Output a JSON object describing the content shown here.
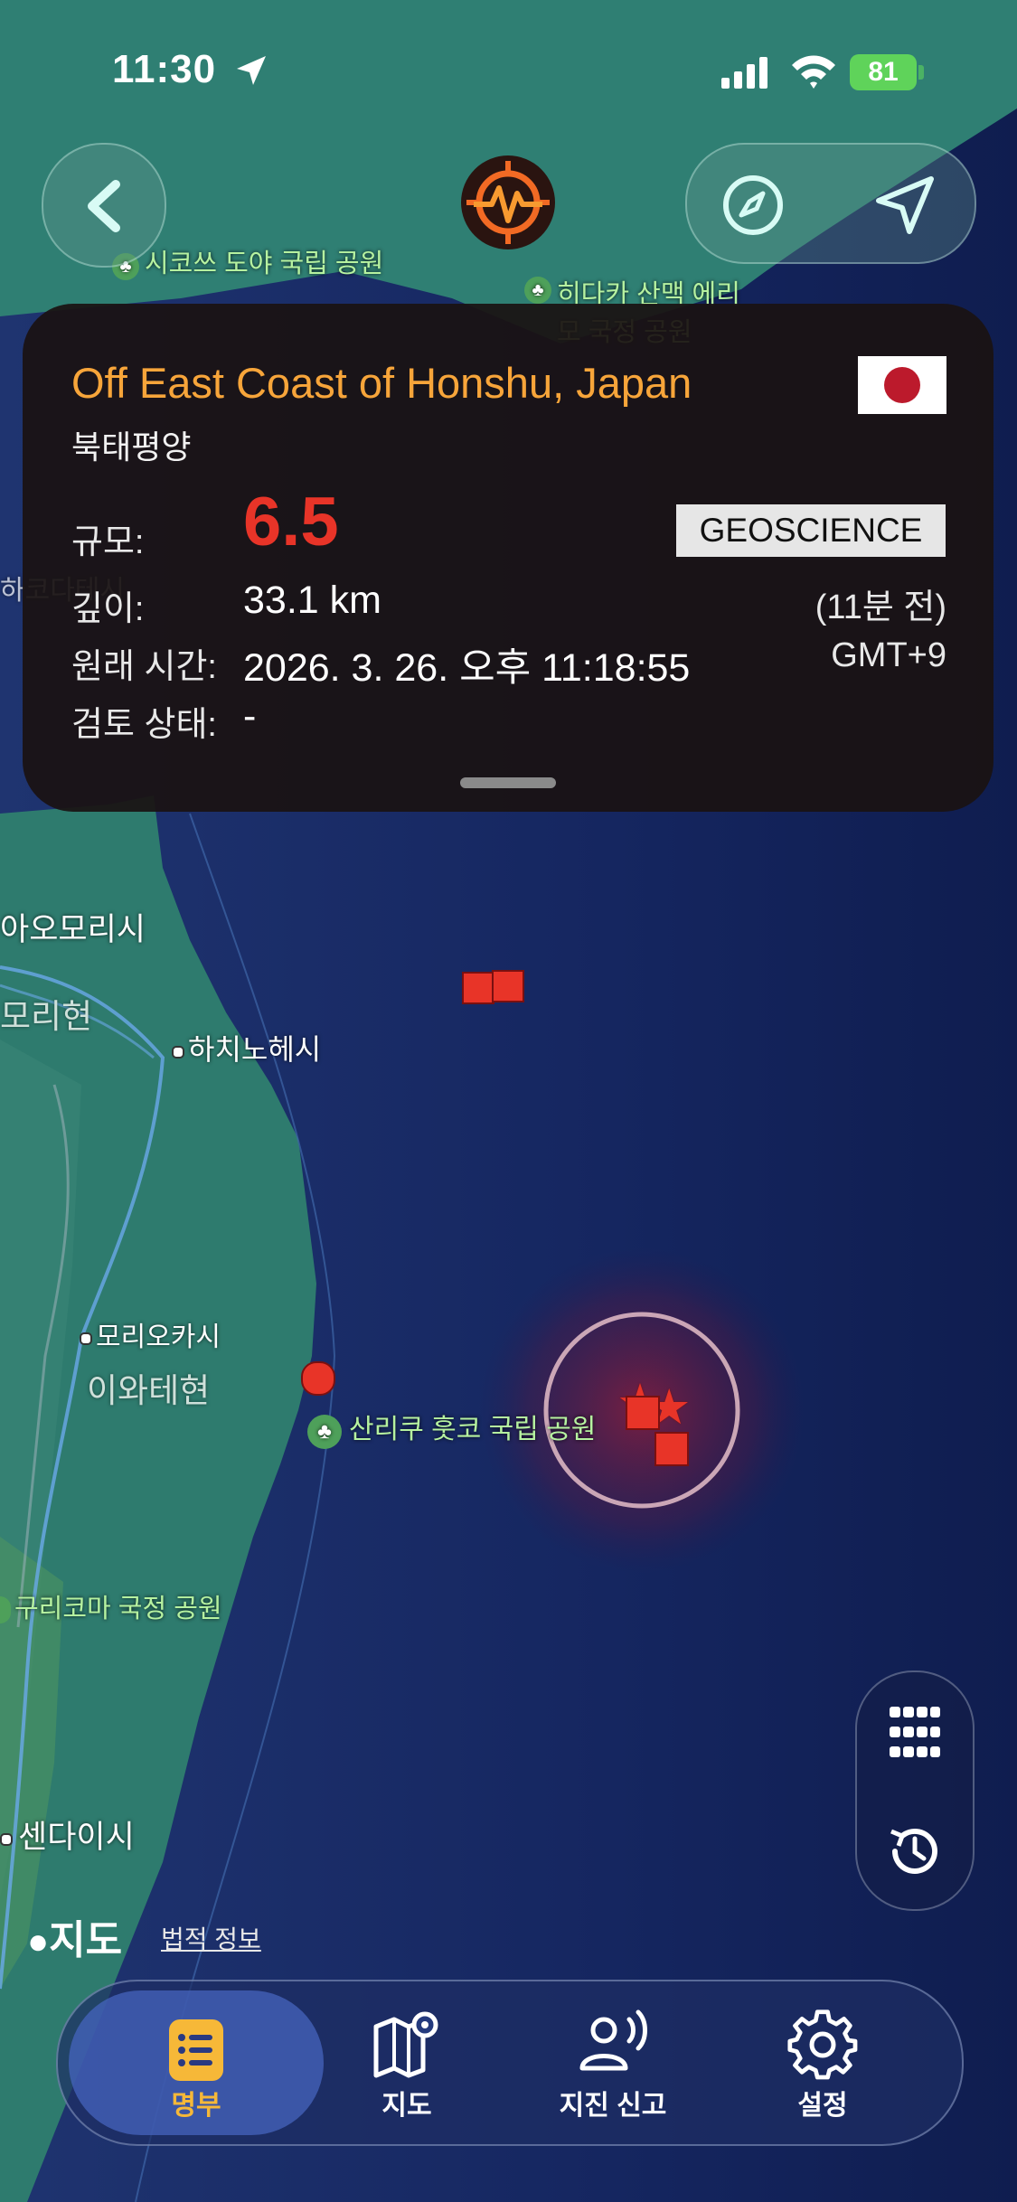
{
  "status_bar": {
    "time": "11:30",
    "battery": "81"
  },
  "earthquake": {
    "place": "Off East Coast of Honshu, Japan",
    "region": "북태평양",
    "labels": {
      "magnitude": "규모:",
      "depth": "깊이:",
      "origin_time": "원래 시간:",
      "review_status": "검토 상태:"
    },
    "magnitude": "6.5",
    "depth": "33.1 km",
    "origin_time": "2026. 3. 26. 오후 11:18:55",
    "review_status": "-",
    "source": "GEOSCIENCE",
    "time_ago": "(11분 전)",
    "timezone": "GMT+9",
    "magnitude_color": "#e83428",
    "place_color": "#f7a53a"
  },
  "map": {
    "labels": {
      "shikotsu": "시코쓰 도야 국립 공원",
      "hidaka": "히다카 산맥 에리모 국정 공원",
      "aomori_city": "아오모리시",
      "aomori_pref": "모리현",
      "hachinohe": "하치노헤시",
      "morioka": "모리오카시",
      "iwate": "이와테현",
      "sanriku": "산리쿠 훗코 국립 공원",
      "kurikoma": "구리코마 국정 공원",
      "sendai": "센다이시",
      "hakodate": "하코다테시"
    }
  },
  "attribution": {
    "apple_maps": "지도",
    "legal": "법적 정보"
  },
  "tabs": [
    {
      "label": "명부",
      "icon": "list-icon",
      "active": true
    },
    {
      "label": "지도",
      "icon": "map-icon",
      "active": false
    },
    {
      "label": "지진 신고",
      "icon": "report-person-icon",
      "active": false
    },
    {
      "label": "설정",
      "icon": "gear-icon",
      "active": false
    }
  ],
  "icons": {
    "back": "chevron-left-icon",
    "logo": "earthquake-logo-icon",
    "compass": "compass-icon",
    "location": "location-arrow-icon",
    "grid": "grid-icon",
    "history": "history-icon"
  },
  "colors": {
    "accent_active_tab": "#f6b838",
    "event_marker": "#e83428"
  }
}
